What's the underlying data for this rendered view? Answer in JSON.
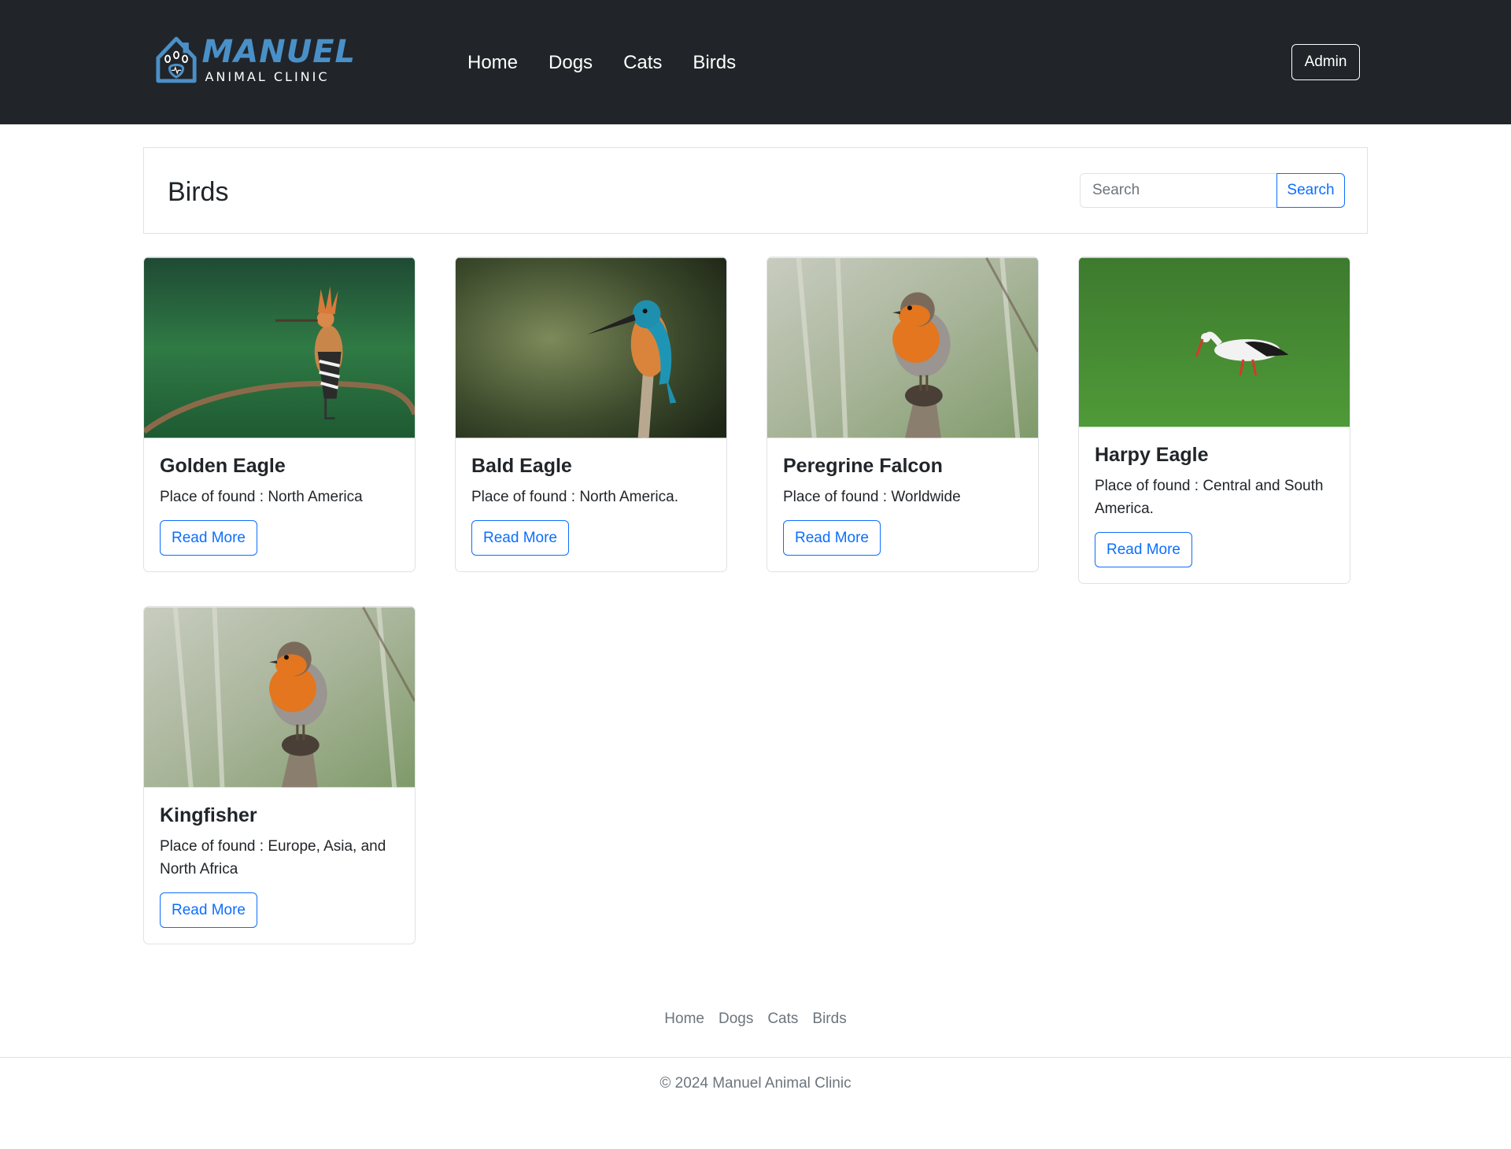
{
  "brand": {
    "name": "MANUEL",
    "subtitle": "ANIMAL CLINIC"
  },
  "nav": {
    "items": [
      {
        "label": "Home"
      },
      {
        "label": "Dogs"
      },
      {
        "label": "Cats"
      },
      {
        "label": "Birds"
      }
    ],
    "admin_label": "Admin"
  },
  "page": {
    "title": "Birds",
    "search_placeholder": "Search",
    "search_button": "Search"
  },
  "cards": [
    {
      "title": "Golden Eagle",
      "text": "Place of found : North America",
      "button": "Read More",
      "image": "hoopoe on branch"
    },
    {
      "title": "Bald Eagle",
      "text": "Place of found : North America.",
      "button": "Read More",
      "image": "kingfisher on stick"
    },
    {
      "title": "Peregrine Falcon",
      "text": "Place of found : Worldwide",
      "button": "Read More",
      "image": "robin on stump"
    },
    {
      "title": "Harpy Eagle",
      "text": "Place of found : Central and South America.",
      "button": "Read More",
      "image": "stork in grass"
    },
    {
      "title": "Kingfisher",
      "text": "Place of found : Europe, Asia, and North Africa",
      "button": "Read More",
      "image": "robin on stump"
    }
  ],
  "footer": {
    "links": [
      {
        "label": "Home"
      },
      {
        "label": "Dogs"
      },
      {
        "label": "Cats"
      },
      {
        "label": "Birds"
      }
    ],
    "copyright": "© 2024 Manuel Animal Clinic"
  },
  "colors": {
    "navbar": "#212529",
    "primary": "#0d6efd",
    "muted": "#6c757d",
    "border": "#dee2e6",
    "logo_blue": "#4a90c8"
  }
}
